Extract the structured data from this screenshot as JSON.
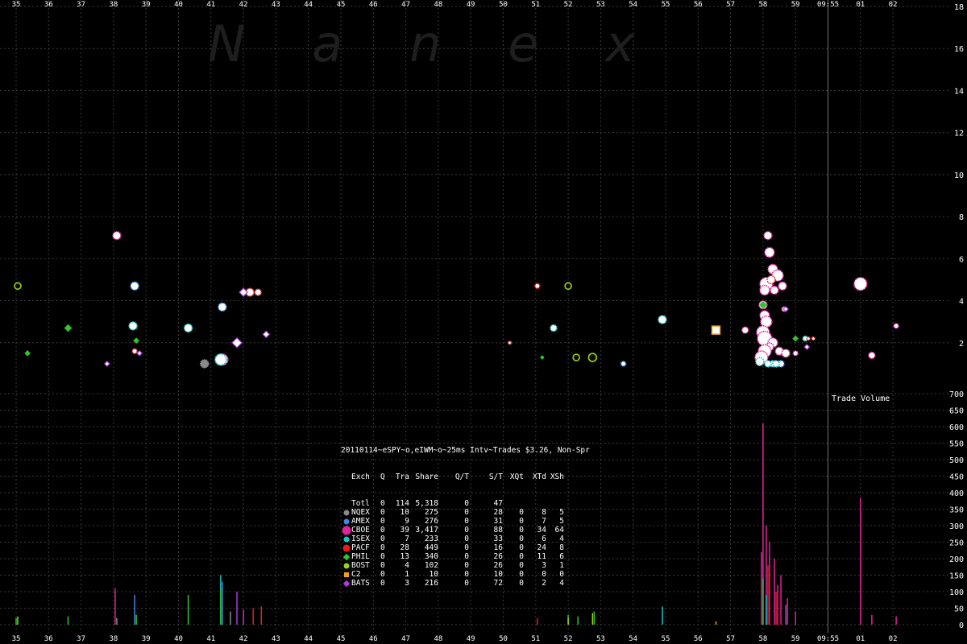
{
  "watermark": "N a n e x",
  "chart_data": {
    "type": "scatter",
    "upper_y_ticks": [
      2,
      4,
      6,
      8,
      10,
      12,
      14,
      16,
      18
    ],
    "upper_ylim": [
      0,
      18
    ],
    "lower_y_ticks": [
      0,
      50,
      100,
      150,
      200,
      250,
      300,
      350,
      400,
      450,
      500,
      550,
      600,
      650,
      700
    ],
    "lower_ylim": [
      0,
      700
    ],
    "lower_title": "Trade Volume",
    "x_ticks": [
      "35",
      "36",
      "37",
      "38",
      "39",
      "40",
      "41",
      "42",
      "43",
      "44",
      "45",
      "46",
      "47",
      "48",
      "49",
      "50",
      "51",
      "52",
      "53",
      "54",
      "55",
      "56",
      "57",
      "58",
      "59",
      "09:55",
      "01",
      "02"
    ],
    "x_tick_values": [
      35,
      36,
      37,
      38,
      39,
      40,
      41,
      42,
      43,
      44,
      45,
      46,
      47,
      48,
      49,
      50,
      51,
      52,
      53,
      54,
      55,
      56,
      57,
      58,
      59,
      60,
      61,
      62
    ],
    "xlim": [
      34.85,
      63.3
    ],
    "marker_time": 60,
    "legend": {
      "title": "20110114~eSPY~o,eIWM~o~25ms Intv~Trades $3.26, Non-Spr",
      "columns": [
        "Exch",
        "Q",
        "Tra",
        "Share",
        "Q/T",
        "S/T",
        "XQt",
        "XTd",
        "XSh"
      ],
      "rows": [
        {
          "exch": "Totl",
          "q": "0",
          "tra": "114",
          "share": "5,318",
          "qt": "0",
          "st": "47",
          "xqt": "",
          "xtd": "",
          "xsh": "",
          "color": "",
          "shape": "none"
        },
        {
          "exch": "NQEX",
          "q": "0",
          "tra": "10",
          "share": "275",
          "qt": "0",
          "st": "28",
          "xqt": "0",
          "xtd": "8",
          "xsh": "5",
          "color": "#8a8a8a",
          "shape": "circle"
        },
        {
          "exch": "AMEX",
          "q": "0",
          "tra": "9",
          "share": "276",
          "qt": "0",
          "st": "31",
          "xqt": "0",
          "xtd": "7",
          "xsh": "5",
          "color": "#3a8ae0",
          "shape": "circle"
        },
        {
          "exch": "CBOE",
          "q": "0",
          "tra": "39",
          "share": "3,417",
          "qt": "0",
          "st": "88",
          "xqt": "0",
          "xtd": "34",
          "xsh": "64",
          "color": "#e0239a",
          "shape": "circle-big"
        },
        {
          "exch": "ISEX",
          "q": "0",
          "tra": "7",
          "share": "233",
          "qt": "0",
          "st": "33",
          "xqt": "0",
          "xtd": "6",
          "xsh": "4",
          "color": "#17c7c7",
          "shape": "circle"
        },
        {
          "exch": "PACF",
          "q": "0",
          "tra": "28",
          "share": "449",
          "qt": "0",
          "st": "16",
          "xqt": "0",
          "xtd": "24",
          "xsh": "8",
          "color": "#e81e1e",
          "shape": "circle-mid"
        },
        {
          "exch": "PHIL",
          "q": "0",
          "tra": "13",
          "share": "340",
          "qt": "0",
          "st": "26",
          "xqt": "0",
          "xtd": "11",
          "xsh": "6",
          "color": "#2ec52e",
          "shape": "diamond"
        },
        {
          "exch": "BOST",
          "q": "0",
          "tra": "4",
          "share": "102",
          "qt": "0",
          "st": "26",
          "xqt": "0",
          "xtd": "3",
          "xsh": "1",
          "color": "#9ad11e",
          "shape": "circle"
        },
        {
          "exch": "C2",
          "q": "0",
          "tra": "1",
          "share": "10",
          "qt": "0",
          "st": "10",
          "xqt": "0",
          "xtd": "0",
          "xsh": "0",
          "color": "#f0a020",
          "shape": "square"
        },
        {
          "exch": "BATS",
          "q": "0",
          "tra": "3",
          "share": "216",
          "qt": "0",
          "st": "72",
          "xqt": "0",
          "xtd": "2",
          "xsh": "4",
          "color": "#b038e0",
          "shape": "diamond"
        }
      ]
    },
    "series": [
      {
        "name": "NQEX",
        "color": "#8a8a8a",
        "points": [
          [
            40.8,
            1.0,
            5
          ]
        ],
        "volume": [
          [
            38.1,
            20
          ],
          [
            41.6,
            40
          ]
        ]
      },
      {
        "name": "AMEX",
        "color": "#3a8ae0",
        "points": [
          [
            38.65,
            4.7,
            5
          ],
          [
            41.35,
            3.7,
            5
          ],
          [
            53.7,
            1.0,
            3
          ],
          [
            58.3,
            1.0,
            4
          ],
          [
            58.55,
            1.0,
            4
          ]
        ],
        "volume": [
          [
            38.65,
            90
          ],
          [
            41.35,
            130
          ]
        ]
      },
      {
        "name": "CBOE",
        "color": "#e0239a",
        "points": [
          [
            38.1,
            7.1,
            5
          ],
          [
            41.35,
            1.2,
            7
          ],
          [
            57.45,
            2.6,
            4
          ],
          [
            58.15,
            7.1,
            5
          ],
          [
            58.2,
            6.3,
            6
          ],
          [
            58.3,
            5.5,
            6
          ],
          [
            58.45,
            5.2,
            7
          ],
          [
            58.1,
            4.8,
            8
          ],
          [
            58.35,
            4.5,
            5
          ],
          [
            58.6,
            4.7,
            5
          ],
          [
            58.05,
            4.5,
            6
          ],
          [
            58.0,
            3.8,
            5
          ],
          [
            58.05,
            3.3,
            6
          ],
          [
            58.1,
            3.0,
            7
          ],
          [
            58.0,
            2.5,
            8
          ],
          [
            58.05,
            2.2,
            9
          ],
          [
            58.3,
            2.0,
            6
          ],
          [
            58.2,
            1.8,
            5
          ],
          [
            58.05,
            1.6,
            8
          ],
          [
            57.95,
            1.3,
            8
          ],
          [
            58.5,
            1.6,
            5
          ],
          [
            58.7,
            1.5,
            5
          ],
          [
            58.65,
            3.6,
            3
          ],
          [
            59.0,
            1.5,
            3
          ],
          [
            61.0,
            4.8,
            8
          ],
          [
            61.35,
            1.4,
            4
          ],
          [
            62.1,
            2.8,
            3
          ]
        ],
        "volume": [
          [
            38.05,
            110
          ],
          [
            58.0,
            610
          ],
          [
            58.1,
            300
          ],
          [
            58.2,
            250
          ],
          [
            58.35,
            200
          ],
          [
            58.55,
            150
          ],
          [
            57.95,
            220
          ],
          [
            58.45,
            120
          ],
          [
            58.75,
            80
          ],
          [
            59.0,
            40
          ],
          [
            61.0,
            385
          ],
          [
            61.35,
            30
          ],
          [
            62.1,
            25
          ]
        ]
      },
      {
        "name": "ISEX",
        "color": "#17c7c7",
        "points": [
          [
            38.6,
            2.8,
            5
          ],
          [
            40.3,
            2.7,
            5
          ],
          [
            41.3,
            1.2,
            7
          ],
          [
            51.55,
            2.7,
            4
          ],
          [
            54.9,
            3.1,
            5
          ],
          [
            57.9,
            1.1,
            5
          ],
          [
            58.15,
            1.0,
            4
          ],
          [
            58.4,
            1.0,
            4
          ],
          [
            59.3,
            2.2,
            3
          ]
        ],
        "volume": [
          [
            41.3,
            150
          ],
          [
            54.9,
            55
          ],
          [
            58.1,
            90
          ]
        ]
      },
      {
        "name": "PACF",
        "color": "#e81e1e",
        "points": [
          [
            38.65,
            1.6,
            3
          ],
          [
            42.2,
            4.4,
            5
          ],
          [
            42.45,
            4.4,
            4
          ],
          [
            50.2,
            2.0,
            2
          ],
          [
            51.05,
            4.7,
            3
          ],
          [
            58.25,
            5.0,
            5
          ],
          [
            59.4,
            2.2,
            2
          ],
          [
            59.55,
            2.2,
            2
          ]
        ],
        "volume": [
          [
            42.3,
            50
          ],
          [
            42.55,
            55
          ],
          [
            51.05,
            20
          ],
          [
            58.15,
            180
          ],
          [
            58.4,
            100
          ]
        ]
      },
      {
        "name": "PHIL",
        "color": "#2ec52e",
        "points": [
          [
            35.35,
            1.5,
            3
          ],
          [
            36.6,
            2.7,
            4
          ],
          [
            38.7,
            2.1,
            3
          ],
          [
            51.2,
            1.3,
            2
          ],
          [
            58.0,
            3.8,
            4
          ],
          [
            59.0,
            2.2,
            3
          ]
        ],
        "volume": [
          [
            35.0,
            20
          ],
          [
            36.6,
            25
          ],
          [
            38.7,
            30
          ],
          [
            40.3,
            90
          ],
          [
            41.3,
            110
          ],
          [
            52.0,
            30
          ],
          [
            52.3,
            25
          ],
          [
            52.8,
            40
          ],
          [
            58.0,
            140
          ]
        ]
      },
      {
        "name": "BOST",
        "color": "#9ad11e",
        "points": [
          [
            35.05,
            4.7,
            4
          ],
          [
            52.0,
            4.7,
            4
          ],
          [
            52.25,
            1.3,
            4
          ],
          [
            52.75,
            1.3,
            5
          ]
        ],
        "volume": [
          [
            35.05,
            25
          ],
          [
            52.0,
            20
          ],
          [
            52.75,
            35
          ]
        ]
      },
      {
        "name": "C2",
        "color": "#f0a020",
        "points": [
          [
            56.55,
            2.6,
            5
          ]
        ],
        "volume": [
          [
            56.55,
            10
          ]
        ]
      },
      {
        "name": "BATS",
        "color": "#b038e0",
        "points": [
          [
            41.8,
            2.0,
            6
          ],
          [
            42.0,
            4.4,
            5
          ],
          [
            38.8,
            1.5,
            3
          ],
          [
            37.8,
            1.0,
            3
          ],
          [
            42.7,
            2.4,
            4
          ],
          [
            58.7,
            3.6,
            3
          ],
          [
            59.35,
            1.8,
            3
          ]
        ],
        "volume": [
          [
            41.8,
            100
          ],
          [
            42.0,
            45
          ],
          [
            58.7,
            60
          ]
        ]
      }
    ]
  }
}
